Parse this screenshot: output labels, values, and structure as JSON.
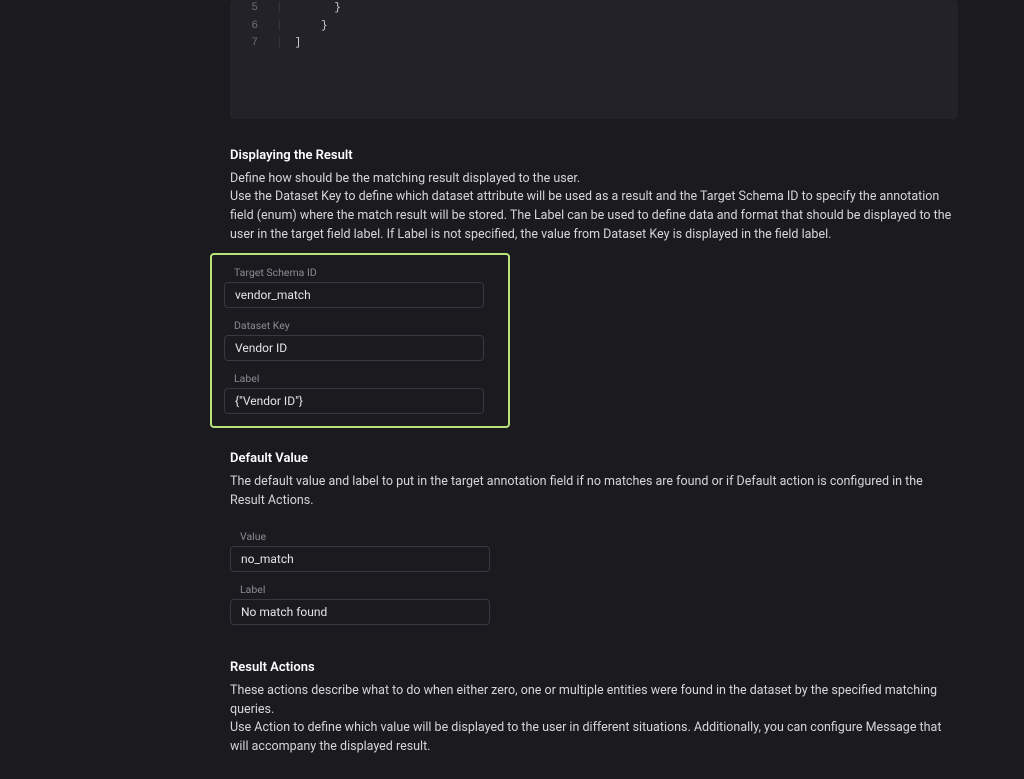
{
  "code_block": {
    "lines": [
      {
        "number": "5",
        "text": "      }"
      },
      {
        "number": "6",
        "text": "    }"
      },
      {
        "number": "7",
        "text": "]"
      }
    ]
  },
  "sections": {
    "displaying": {
      "heading": "Displaying the Result",
      "desc1": "Define how should be the matching result displayed to the user.",
      "desc2": "Use the Dataset Key to define which dataset attribute will be used as a result and the Target Schema ID to specify the annotation field (enum) where the match result will be stored. The Label can be used to define data and format that should be displayed to the user in the target field label. If Label is not specified, the value from Dataset Key is displayed in the field label.",
      "fields": {
        "target_schema_id": {
          "label": "Target Schema ID",
          "value": "vendor_match"
        },
        "dataset_key": {
          "label": "Dataset Key",
          "value": "Vendor ID"
        },
        "label": {
          "label": "Label",
          "value": "{\"Vendor ID\"}"
        }
      }
    },
    "default_value": {
      "heading": "Default Value",
      "desc": "The default value and label to put in the target annotation field if no matches are found or if Default action is configured in the Result Actions.",
      "fields": {
        "value": {
          "label": "Value",
          "value": "no_match"
        },
        "label": {
          "label": "Label",
          "value": "No match found"
        }
      }
    },
    "result_actions": {
      "heading": "Result Actions",
      "desc1": "These actions describe what to do when either zero, one or multiple entities were found in the dataset by the specified matching queries.",
      "desc2": "Use Action to define which value will be displayed to the user in different situations. Additionally, you can configure Message that will accompany the displayed result."
    }
  }
}
